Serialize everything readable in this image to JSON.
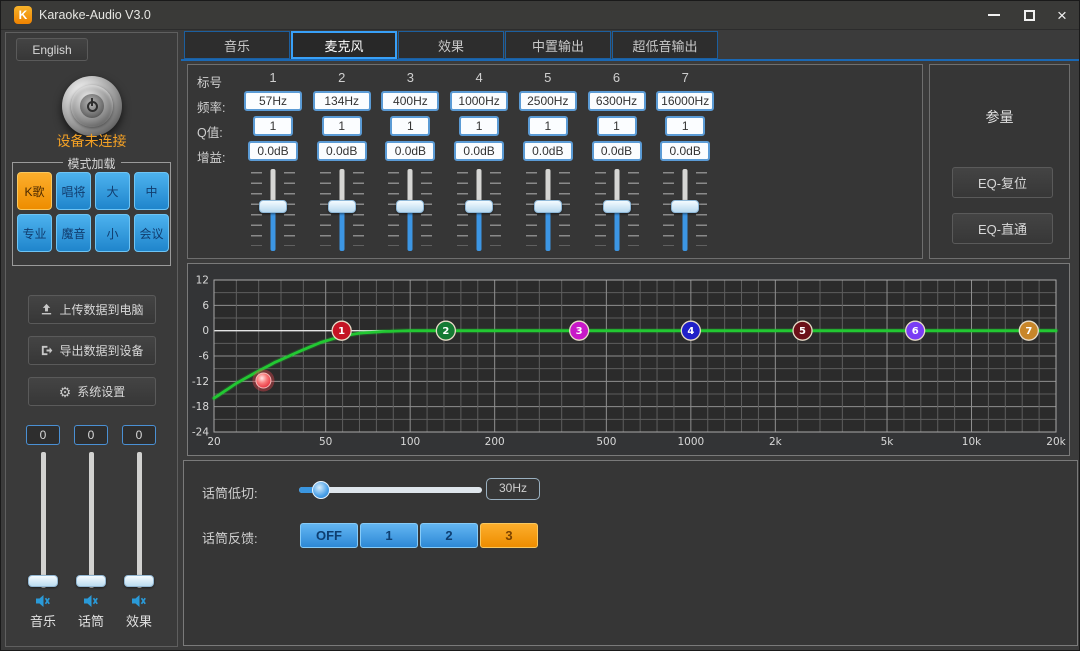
{
  "window": {
    "title": "Karaoke-Audio V3.0",
    "logo_letter": "K",
    "close_glyph": "×"
  },
  "sidebar": {
    "language_button": "English",
    "device_status": "设备未连接",
    "mode_group_title": "模式加载",
    "modes": [
      {
        "label": "K歌",
        "active": true
      },
      {
        "label": "唱将",
        "active": false
      },
      {
        "label": "大",
        "active": false
      },
      {
        "label": "中",
        "active": false
      },
      {
        "label": "专业",
        "active": false
      },
      {
        "label": "魔音",
        "active": false
      },
      {
        "label": "小",
        "active": false
      },
      {
        "label": "会议",
        "active": false
      }
    ],
    "buttons": {
      "upload": "上传数据到电脑",
      "export": "导出数据到设备",
      "settings": "系统设置"
    },
    "volumes": [
      {
        "label": "音乐",
        "value": "0"
      },
      {
        "label": "话筒",
        "value": "0"
      },
      {
        "label": "效果",
        "value": "0"
      }
    ]
  },
  "tabs": {
    "items": [
      {
        "label": "音乐",
        "active": false
      },
      {
        "label": "麦克风",
        "active": true
      },
      {
        "label": "效果",
        "active": false
      },
      {
        "label": "中置输出",
        "active": false
      },
      {
        "label": "超低音输出",
        "active": false
      }
    ]
  },
  "eq": {
    "row_labels": {
      "index": "标号",
      "freq": "频率:",
      "q": "Q值:",
      "gain": "增益:"
    },
    "bands": [
      {
        "index": "1",
        "freq": "57Hz",
        "q": "1",
        "gain": "0.0dB"
      },
      {
        "index": "2",
        "freq": "134Hz",
        "q": "1",
        "gain": "0.0dB"
      },
      {
        "index": "3",
        "freq": "400Hz",
        "q": "1",
        "gain": "0.0dB"
      },
      {
        "index": "4",
        "freq": "1000Hz",
        "q": "1",
        "gain": "0.0dB"
      },
      {
        "index": "5",
        "freq": "2500Hz",
        "q": "1",
        "gain": "0.0dB"
      },
      {
        "index": "6",
        "freq": "6300Hz",
        "q": "1",
        "gain": "0.0dB"
      },
      {
        "index": "7",
        "freq": "16000Hz",
        "q": "1",
        "gain": "0.0dB"
      }
    ]
  },
  "params_panel": {
    "title": "参量",
    "reset_button": "EQ-复位",
    "bypass_button": "EQ-直通"
  },
  "mic_controls": {
    "lowcut_label": "话筒低切:",
    "lowcut_value": "30Hz",
    "feedback_label": "话筒反馈:",
    "feedback_options": [
      {
        "label": "OFF",
        "active": false
      },
      {
        "label": "1",
        "active": false
      },
      {
        "label": "2",
        "active": false
      },
      {
        "label": "3",
        "active": true
      }
    ]
  },
  "chart_data": {
    "type": "line",
    "title": "",
    "xlabel": "",
    "ylabel": "",
    "x_scale": "log",
    "x_range": [
      20,
      20000
    ],
    "y_range": [
      -24,
      12
    ],
    "grid": true,
    "x_ticks": [
      {
        "value": 20,
        "label": "20"
      },
      {
        "value": 50,
        "label": "50"
      },
      {
        "value": 100,
        "label": "100"
      },
      {
        "value": 200,
        "label": "200"
      },
      {
        "value": 500,
        "label": "500"
      },
      {
        "value": 1000,
        "label": "1000"
      },
      {
        "value": 2000,
        "label": "2k"
      },
      {
        "value": 5000,
        "label": "5k"
      },
      {
        "value": 10000,
        "label": "10k"
      },
      {
        "value": 20000,
        "label": "20k"
      }
    ],
    "y_ticks": [
      12,
      6,
      0,
      -6,
      -12,
      -18,
      -24
    ],
    "curve_color": "#22c832",
    "curve_points": [
      [
        20,
        -16
      ],
      [
        24,
        -12.5
      ],
      [
        28,
        -10
      ],
      [
        33,
        -7.5
      ],
      [
        40,
        -5
      ],
      [
        48,
        -2.8
      ],
      [
        57,
        -1.3
      ],
      [
        66,
        -0.6
      ],
      [
        80,
        -0.2
      ],
      [
        100,
        0
      ],
      [
        1000,
        0
      ],
      [
        20000,
        0
      ]
    ],
    "band_markers": [
      {
        "num": "1",
        "freq": 57,
        "gain": 0,
        "color": "#c41425"
      },
      {
        "num": "2",
        "freq": 134,
        "gain": 0,
        "color": "#157a33"
      },
      {
        "num": "3",
        "freq": 400,
        "gain": 0,
        "color": "#c818c8"
      },
      {
        "num": "4",
        "freq": 1000,
        "gain": 0,
        "color": "#2020c8"
      },
      {
        "num": "5",
        "freq": 2500,
        "gain": 0,
        "color": "#6b1018"
      },
      {
        "num": "6",
        "freq": 6300,
        "gain": 0,
        "color": "#7a3cf4"
      },
      {
        "num": "7",
        "freq": 16000,
        "gain": 0,
        "color": "#c8862a"
      }
    ],
    "lowcut_marker": {
      "freq": 30,
      "gain": -11.8,
      "color": "#e02030"
    }
  },
  "colors": {
    "accent_blue": "#2d88d6",
    "accent_orange": "#ee8d00",
    "status_orange": "#f2a025",
    "curve_green": "#22c832",
    "input_border_blue": "#5b9bd5"
  }
}
